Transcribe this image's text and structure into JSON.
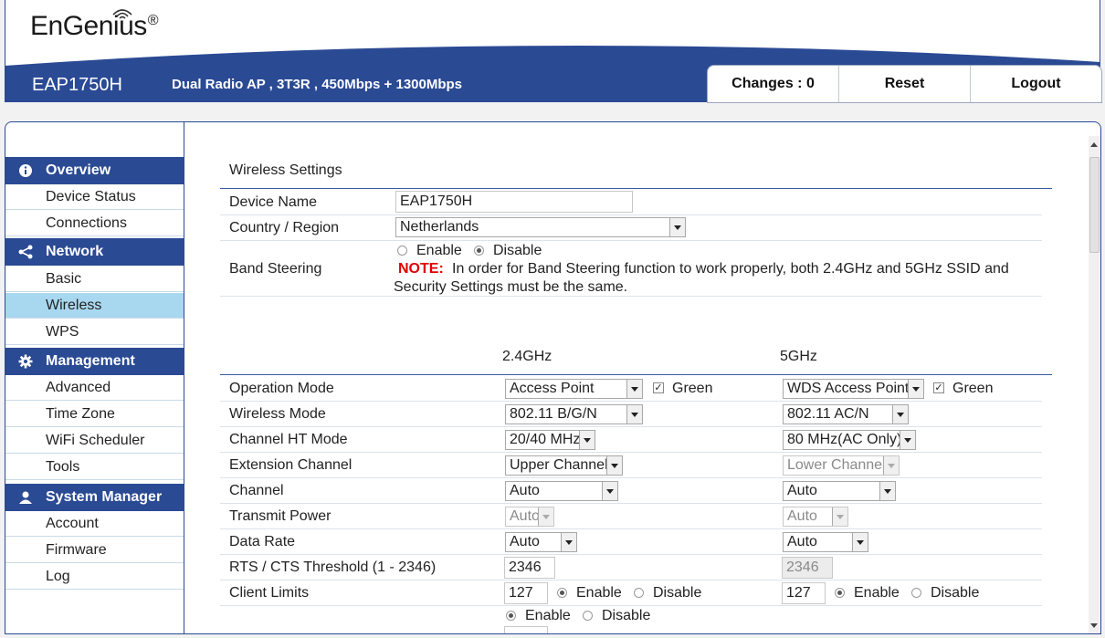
{
  "brand": {
    "logo_text": "EnGenius",
    "reg_mark": "®"
  },
  "header": {
    "model": "EAP1750H",
    "description": "Dual Radio AP , 3T3R , 450Mbps + 1300Mbps"
  },
  "topbar": {
    "changes_label": "Changes : 0",
    "reset_label": "Reset",
    "logout_label": "Logout"
  },
  "sidebar": {
    "overview": {
      "title": "Overview",
      "items": [
        "Device Status",
        "Connections"
      ]
    },
    "network": {
      "title": "Network",
      "items": [
        "Basic",
        "Wireless",
        "WPS"
      ]
    },
    "management": {
      "title": "Management",
      "items": [
        "Advanced",
        "Time Zone",
        "WiFi Scheduler",
        "Tools"
      ]
    },
    "system": {
      "title": "System Manager",
      "items": [
        "Account",
        "Firmware",
        "Log"
      ]
    },
    "active_item": "Wireless"
  },
  "settings": {
    "title": "Wireless Settings",
    "device_name_label": "Device Name",
    "device_name_value": "EAP1750H",
    "country_label": "Country / Region",
    "country_value": "Netherlands",
    "band_steering_label": "Band Steering",
    "enable_label": "Enable",
    "disable_label": "Disable",
    "band_steering_selected": "Disable",
    "note_label": "NOTE:",
    "note_text": "In order for Band Steering function to work properly, both 2.4GHz and 5GHz SSID and",
    "note_text2": "Security Settings must be the same."
  },
  "radios": {
    "band_24": "2.4GHz",
    "band_5": "5GHz",
    "green_label": "Green",
    "rows": [
      {
        "label": "Operation Mode",
        "v24": "Access Point",
        "v5": "WDS Access Point"
      },
      {
        "label": "Wireless Mode",
        "v24": "802.11 B/G/N",
        "v5": "802.11 AC/N"
      },
      {
        "label": "Channel HT Mode",
        "v24": "20/40 MHz",
        "v5": "80 MHz(AC Only)"
      },
      {
        "label": "Extension Channel",
        "v24": "Upper Channel",
        "v5": "Lower Channel"
      },
      {
        "label": "Channel",
        "v24": "Auto",
        "v5": "Auto"
      },
      {
        "label": "Transmit Power",
        "v24": "Auto",
        "v5": "Auto"
      },
      {
        "label": "Data Rate",
        "v24": "Auto",
        "v5": "Auto"
      },
      {
        "label": "RTS / CTS Threshold (1 - 2346)",
        "v24": "2346",
        "v5": "2346"
      },
      {
        "label": "Client Limits",
        "v24": "127",
        "v5": "127"
      }
    ],
    "client_limits_enable": "Enable",
    "client_limits_disable": "Disable",
    "bottom_enable": "Enable",
    "bottom_disable": "Disable"
  }
}
